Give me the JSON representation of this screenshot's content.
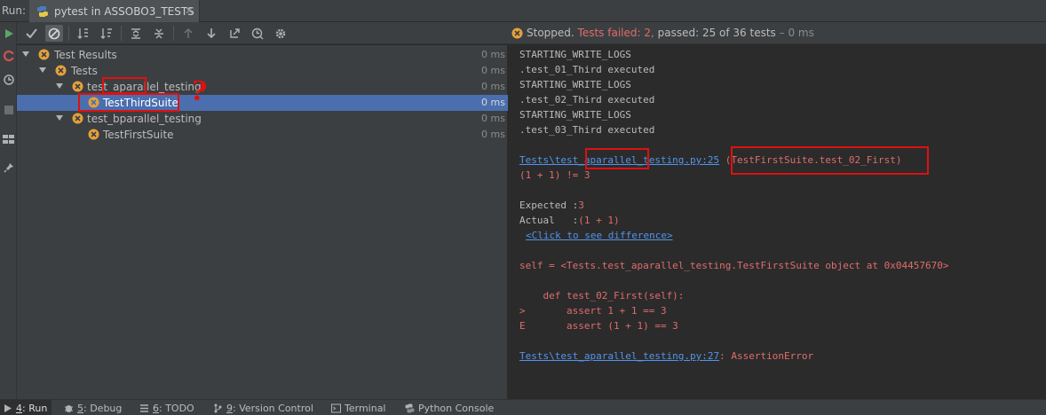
{
  "run_label": "Run:",
  "run_tab": {
    "title": "pytest in ASSOBO3_TESTS",
    "close": "✕"
  },
  "toolbar": {
    "buttons": [
      "show-passed",
      "show-ignored",
      "sort-alpha",
      "sort-duration",
      "expand-all",
      "collapse-all",
      "prev-failed",
      "next-failed",
      "export",
      "history",
      "settings"
    ]
  },
  "tree": {
    "rows": [
      {
        "label": "Test Results",
        "time": "0 ms"
      },
      {
        "label": "Tests",
        "time": "0 ms"
      },
      {
        "label": "test_aparallel_testing",
        "time": "0 ms"
      },
      {
        "label": "TestThirdSuite",
        "time": "0 ms"
      },
      {
        "label": "test_bparallel_testing",
        "time": "0 ms"
      },
      {
        "label": "TestFirstSuite",
        "time": "0 ms"
      }
    ]
  },
  "annotation": {
    "mark": "?"
  },
  "status": {
    "stopped": "Stopped.",
    "failed": "Tests failed: 2,",
    "passed": "passed: 25 of 36 tests",
    "duration": "– 0 ms"
  },
  "console": {
    "lines": [
      "STARTING_WRITE_LOGS",
      ".test_01_Third executed",
      "STARTING_WRITE_LOGS",
      ".test_02_Third executed",
      "STARTING_WRITE_LOGS",
      ".test_03_Third executed"
    ],
    "link1": "Tests\\test_aparallel_testing.py:25",
    "link1_rest": " (TestFirstSuite.test_02_First)",
    "assert_line": "(1 + 1) != 3",
    "expected_label": "Expected :",
    "expected_value": "3",
    "actual_label": "Actual   :",
    "actual_value": "(1 + 1)",
    "diff_link": "<Click to see difference>",
    "self_line": "self = <Tests.test_aparallel_testing.TestFirstSuite object at 0x04457670>",
    "def_line": "    def test_02_First(self):",
    "gt_line": ">       assert 1 + 1 == 3",
    "e_line": "E       assert (1 + 1) == 3",
    "link2": "Tests\\test_aparallel_testing.py:27",
    "link2_rest": ": AssertionError"
  },
  "bottom_tabs": [
    {
      "num": "4",
      "label": ": Run"
    },
    {
      "num": "5",
      "label": ": Debug"
    },
    {
      "num": "6",
      "label": ": TODO"
    },
    {
      "num": "9",
      "label": ": Version Control"
    },
    {
      "num": "",
      "label": "Terminal"
    },
    {
      "num": "",
      "label": "Python Console"
    }
  ],
  "colors": {
    "fail_icon": "#e5a13c",
    "accent_select": "#4b6eaf",
    "error_text": "#e06c6c",
    "link": "#5394ec",
    "annotation": "#e01010"
  }
}
